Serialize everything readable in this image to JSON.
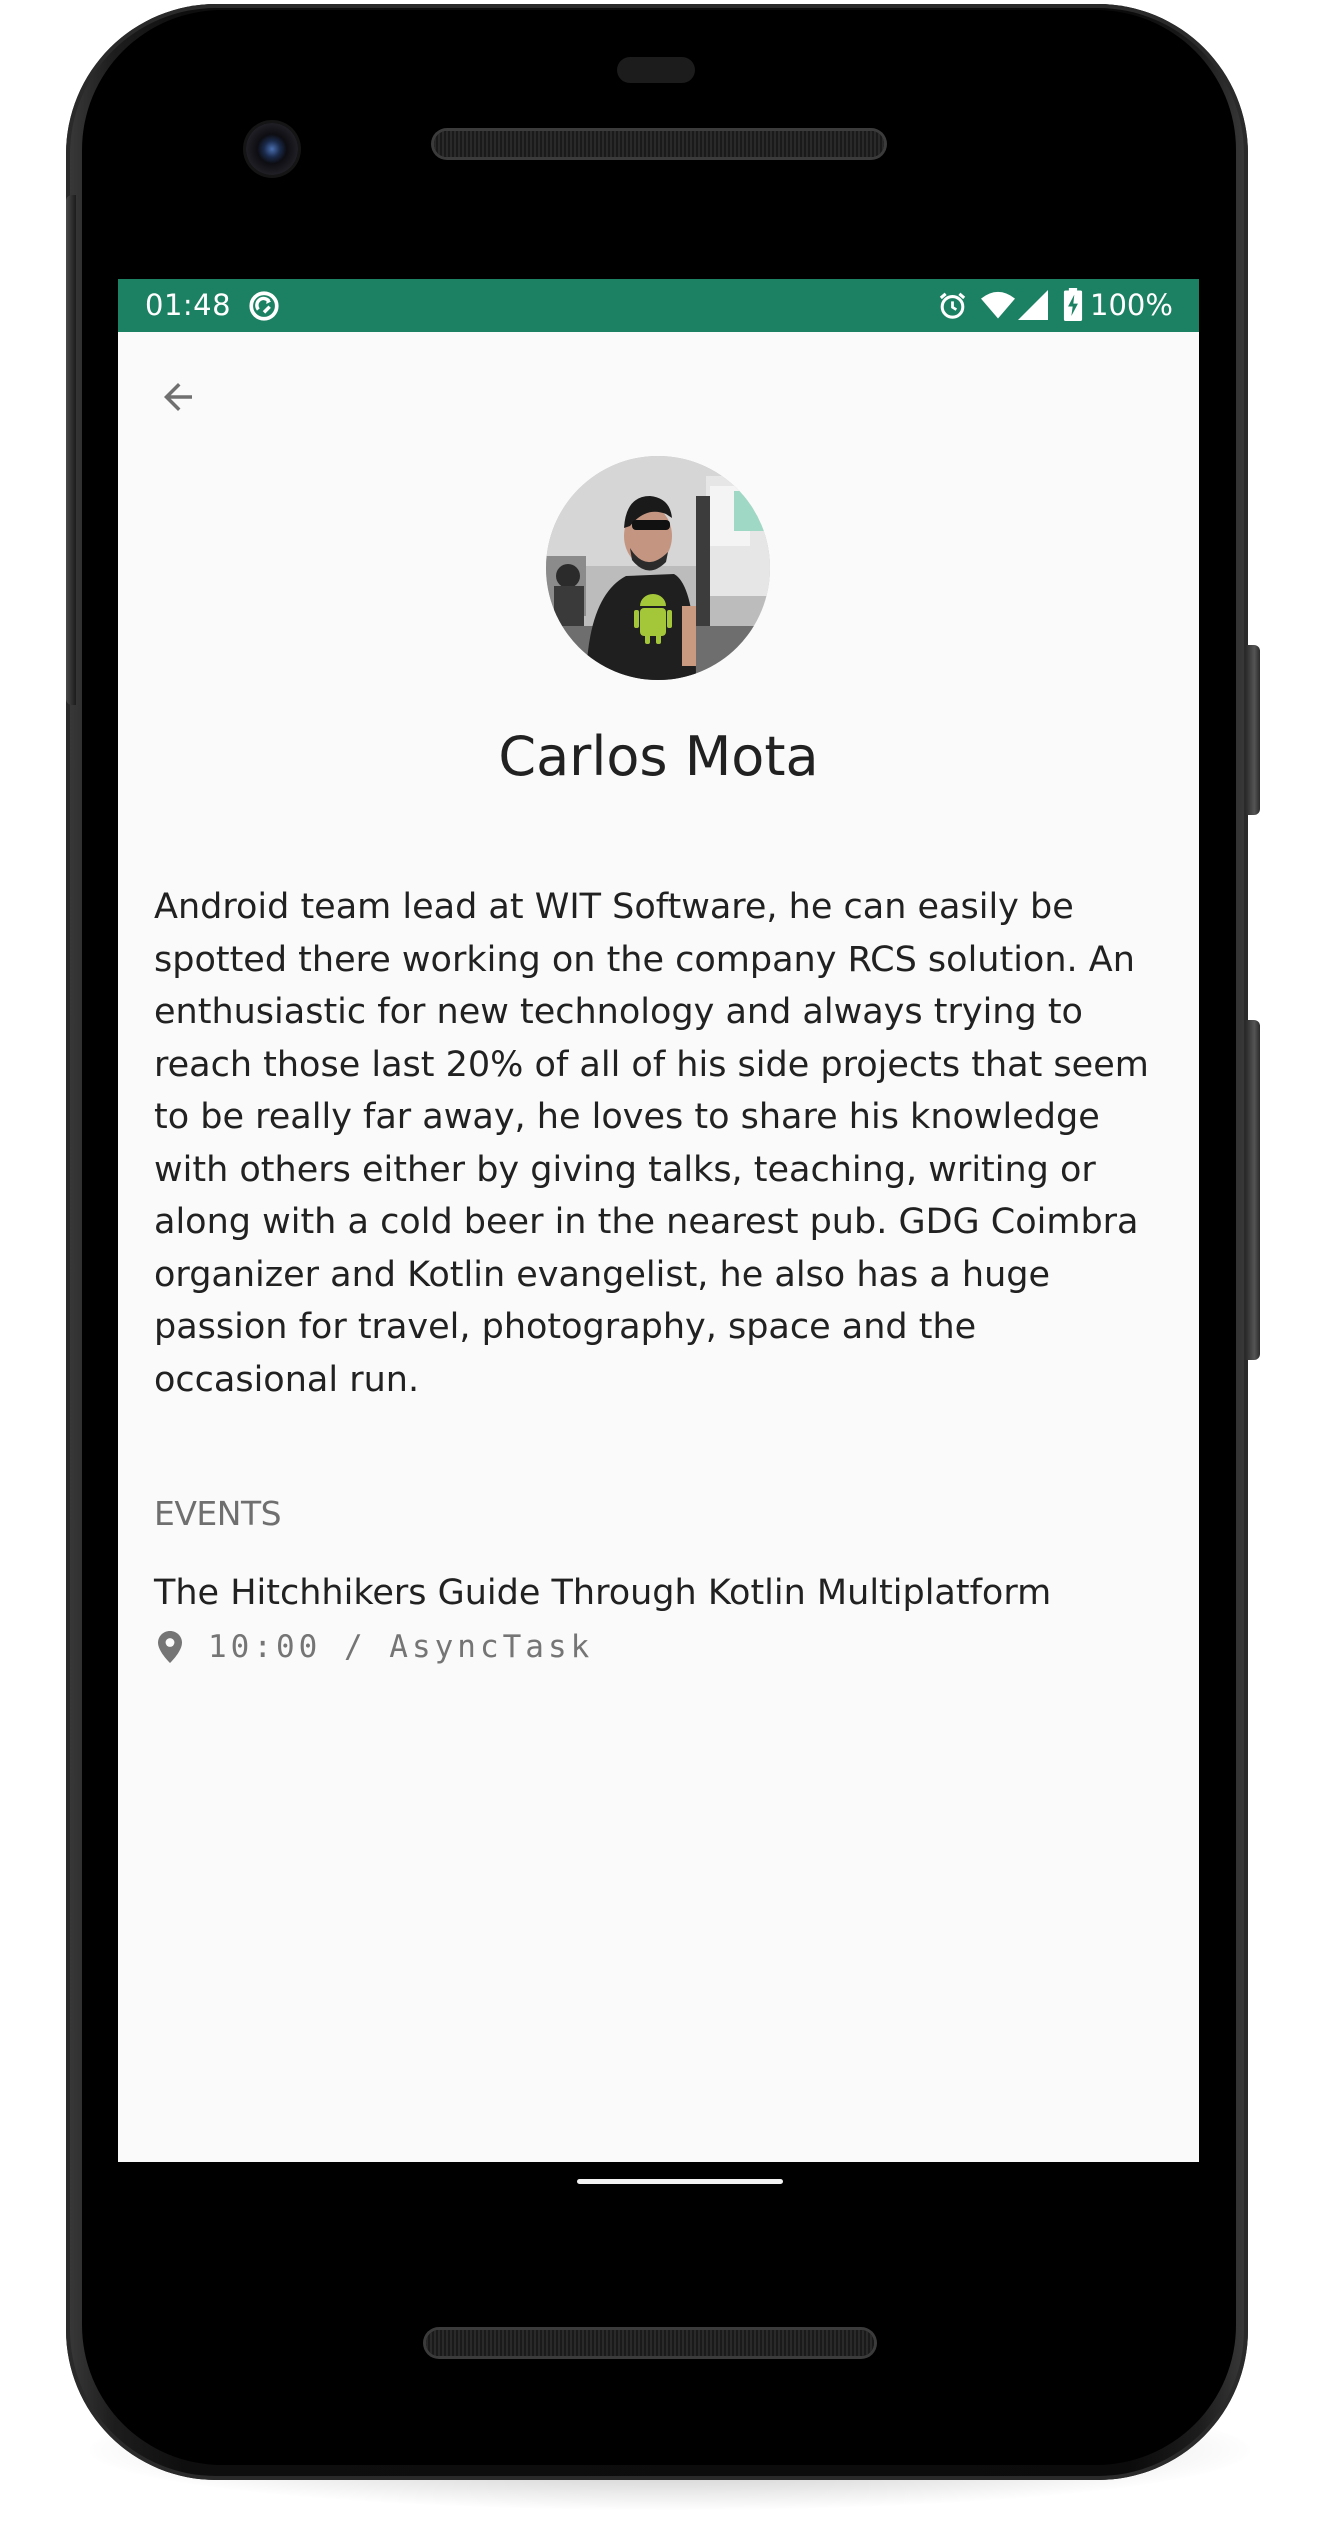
{
  "status_bar": {
    "time": "01:48",
    "battery": "100%",
    "icons": [
      "sync-icon",
      "alarm-icon",
      "wifi-icon",
      "cell-signal-icon",
      "battery-charging-icon"
    ],
    "color": "#1c8062"
  },
  "toolbar": {
    "back_icon": "arrow-back-icon"
  },
  "speaker": {
    "name": "Carlos Mota",
    "bio": "Android team lead at WIT Software, he can easily be spotted there working on the company RCS solution. An enthusiastic for new technology and always trying to reach those last 20% of all of his side projects that seem to be really far away, he loves to share his knowledge with others either by giving talks, teaching, writing or along with a cold beer in the nearest pub. GDG Coimbra organizer and Kotlin evangelist, he also has a huge passion for travel, photography, space and the occasional run."
  },
  "events": {
    "heading": "EVENTS",
    "items": [
      {
        "title": "The Hitchhikers Guide Through Kotlin Multiplatform",
        "time_and_room": "10:00 / AsyncTask",
        "icon": "location-pin-icon"
      }
    ]
  }
}
